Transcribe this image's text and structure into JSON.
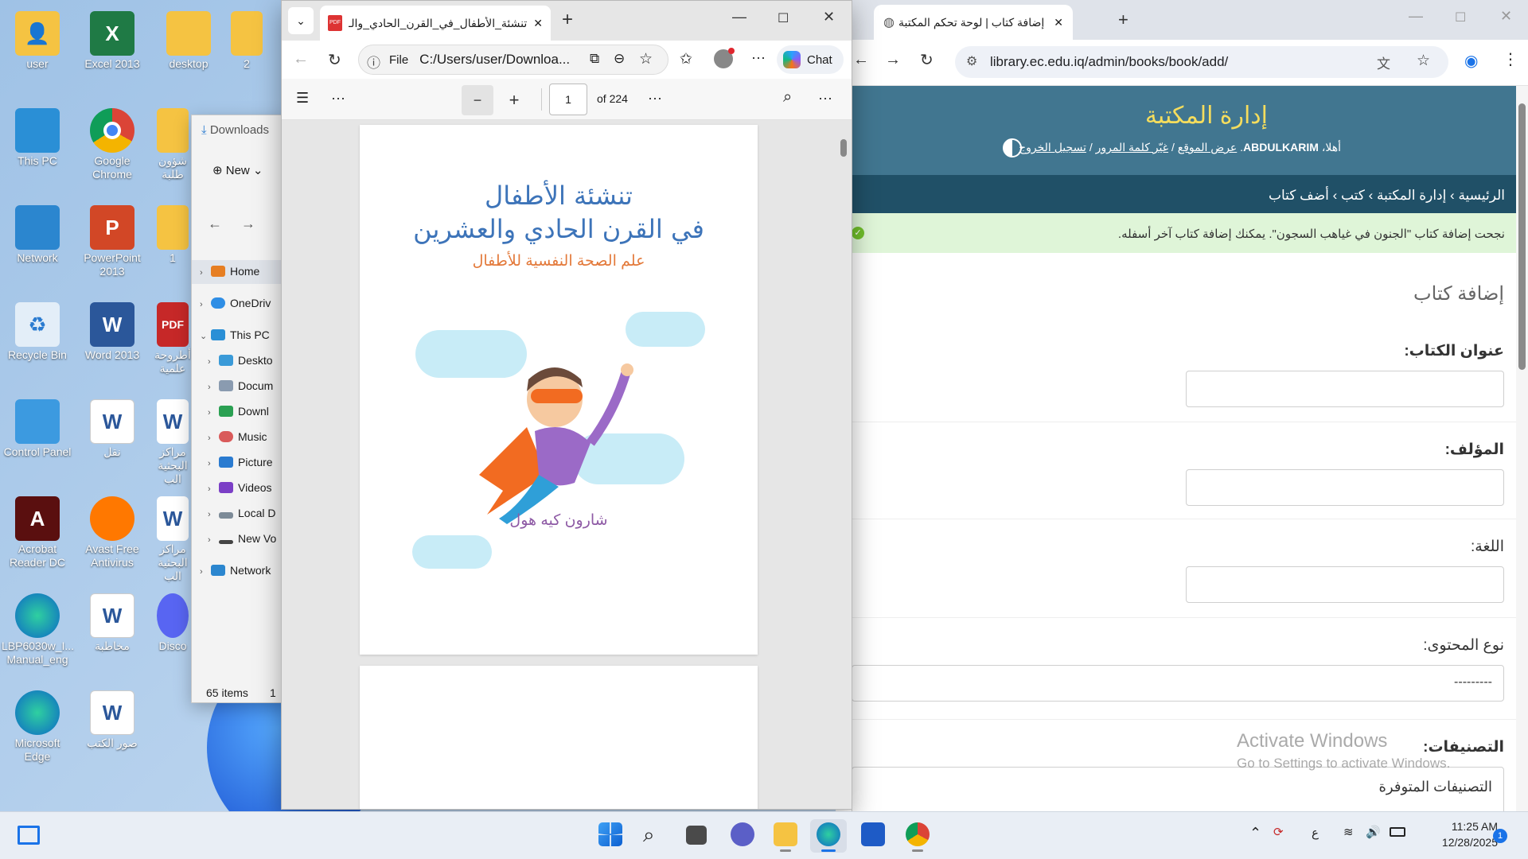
{
  "desktop": {
    "icons": [
      {
        "label": "user"
      },
      {
        "label": "Excel 2013"
      },
      {
        "label": "desktop"
      },
      {
        "label": "2"
      },
      {
        "label": "This PC"
      },
      {
        "label": "Google Chrome"
      },
      {
        "label": "شؤون طلبة"
      },
      {
        "label": "Network"
      },
      {
        "label": "PowerPoint 2013"
      },
      {
        "label": "1"
      },
      {
        "label": "Recycle Bin"
      },
      {
        "label": "Word 2013"
      },
      {
        "label": "أطروحة علمية"
      },
      {
        "label": "Control Panel"
      },
      {
        "label": "نقل"
      },
      {
        "label": "مراكز البحثية الب"
      },
      {
        "label": "Acrobat Reader DC"
      },
      {
        "label": "Avast Free Antivirus"
      },
      {
        "label": "مراكز البحثية الب"
      },
      {
        "label": "LBP6030w_I... Manual_eng"
      },
      {
        "label": "مخاطبة"
      },
      {
        "label": "Disco"
      },
      {
        "label": "Microsoft Edge"
      },
      {
        "label": "صور الكتب"
      }
    ]
  },
  "explorer": {
    "title": "Downloads",
    "new_label": "New",
    "nav": [
      {
        "label": "Home"
      },
      {
        "label": "OneDriv"
      },
      {
        "label": "This PC"
      },
      {
        "label": "Deskto"
      },
      {
        "label": "Docum"
      },
      {
        "label": "Downl"
      },
      {
        "label": "Music"
      },
      {
        "label": "Picture"
      },
      {
        "label": "Videos"
      },
      {
        "label": "Local D"
      },
      {
        "label": "New Vo"
      },
      {
        "label": "Network"
      }
    ],
    "status": "65 items",
    "status2": "1"
  },
  "edge": {
    "tab_title": "تنشئة_الأطفال_في_القرن_الحادي_والـ",
    "address_prefix": "File",
    "address": "C:/Users/user/Downloa...",
    "chat_label": "Chat",
    "page_current": "1",
    "page_total": "of 224",
    "pdf": {
      "title_line1": "تنشئة الأطفال",
      "title_line2": "في القرن الحادي والعشرين",
      "subtitle": "علم الصحة النفسية للأطفال",
      "author": "شارون كيه هول"
    }
  },
  "chrome": {
    "tab_title": "إضافة كتاب | لوحة تحكم المكتبة",
    "url": "library.ec.edu.iq/admin/books/book/add/",
    "site_title": "إدارة المكتبة",
    "user_greeting": "أهلا،",
    "username": "ABDULKARIM",
    "links": [
      "عرض الموقع",
      "غيّر كلمة المرور",
      "تسجيل الخروج"
    ],
    "breadcrumb": "الرئيسية › إدارة المكتبة › كتب › أضف كتاب",
    "success_message": "نجحت إضافة كتاب \"الجنون في غياهب السجون\". يمكنك إضافة كتاب آخر أسفله.",
    "form_title": "إضافة كتاب",
    "fields": {
      "title_label": "عنوان الكتاب:",
      "author_label": "المؤلف:",
      "language_label": "اللغة:",
      "content_type_label": "نوع المحتوى:",
      "content_type_value": "---------",
      "categories_label": "التصنيفات:",
      "available_categories": "التصنيفات المتوفرة"
    },
    "watermark_line1": "Activate Windows",
    "watermark_line2": "Go to Settings to activate Windows."
  },
  "taskbar": {
    "lang": "ع",
    "time": "11:25 AM",
    "date": "12/28/2025",
    "notification_count": "1"
  },
  "colors": {
    "django_header": "#417690",
    "django_bread": "#205067",
    "django_title": "#f5dd5d",
    "success_bg": "#dff5d8",
    "pdf_title": "#3d74b9",
    "pdf_subtitle": "#e3793a",
    "pdf_author": "#8e5aa5"
  }
}
